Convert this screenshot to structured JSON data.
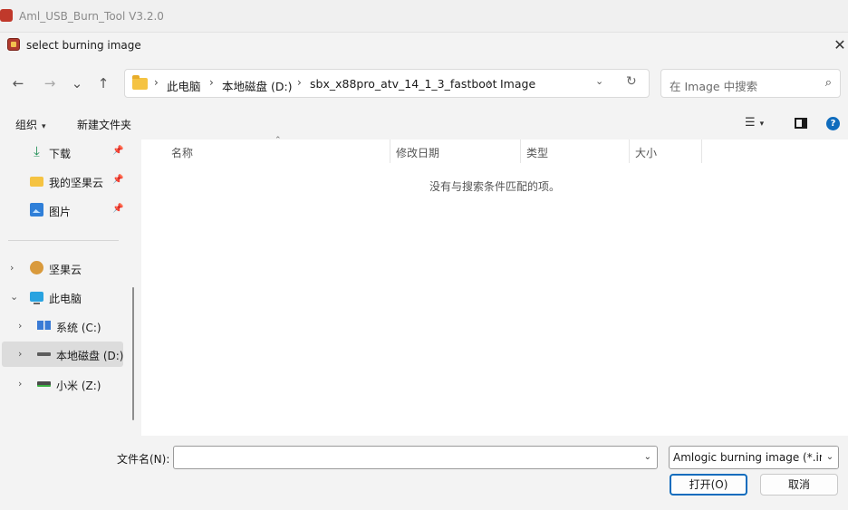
{
  "app": {
    "title": "Aml_USB_Burn_Tool V3.2.0"
  },
  "dialog": {
    "title": "select burning image",
    "close_glyph": "✕"
  },
  "nav": {
    "back_glyph": "←",
    "forward_glyph": "→",
    "recent_glyph": "⌄",
    "up_glyph": "↑",
    "breadcrumbs": [
      "此电脑",
      "本地磁盘 (D:)",
      "sbx_x88pro_atv_14_1_3_fastboot",
      "Image"
    ],
    "breadcrumb_sep": "›",
    "dropdown_glyph": "⌄",
    "refresh_glyph": "↻"
  },
  "search": {
    "placeholder": "在 Image 中搜索",
    "icon": "search-icon",
    "glyph": "⌕"
  },
  "toolbar": {
    "organize_label": "组织",
    "new_folder_label": "新建文件夹",
    "view_glyph": "☰",
    "caret_glyph": "▾",
    "help_glyph": "?"
  },
  "sidebar": {
    "quick_access": [
      {
        "label": "下载",
        "icon": "download-icon"
      },
      {
        "label": "我的坚果云",
        "icon": "folder-icon"
      },
      {
        "label": "图片",
        "icon": "pictures-icon"
      }
    ],
    "pin_glyph": "📌",
    "tree": [
      {
        "label": "坚果云",
        "icon": "nutstore-icon",
        "chev": "›"
      },
      {
        "label": "此电脑",
        "icon": "this-pc-icon",
        "chev": "⌄"
      },
      {
        "label": "系统 (C:)",
        "icon": "windows-drive-icon",
        "chev": "›"
      },
      {
        "label": "本地磁盘 (D:)",
        "icon": "local-drive-icon",
        "chev": "›",
        "selected": true
      },
      {
        "label": "小米 (Z:)",
        "icon": "network-drive-icon",
        "chev": "›"
      }
    ]
  },
  "columns": {
    "name": "名称",
    "date": "修改日期",
    "type": "类型",
    "size": "大小",
    "sort_glyph": "⌃"
  },
  "content": {
    "empty_message": "没有与搜索条件匹配的项。"
  },
  "footer": {
    "filename_label": "文件名(N):",
    "filename_value": "",
    "filetype_value": "Amlogic burning image (*.img)",
    "dropdown_glyph": "⌄",
    "open_label": "打开(O)",
    "cancel_label": "取消"
  },
  "colors": {
    "accent": "#0f6cbd",
    "folder": "#f5c342"
  }
}
